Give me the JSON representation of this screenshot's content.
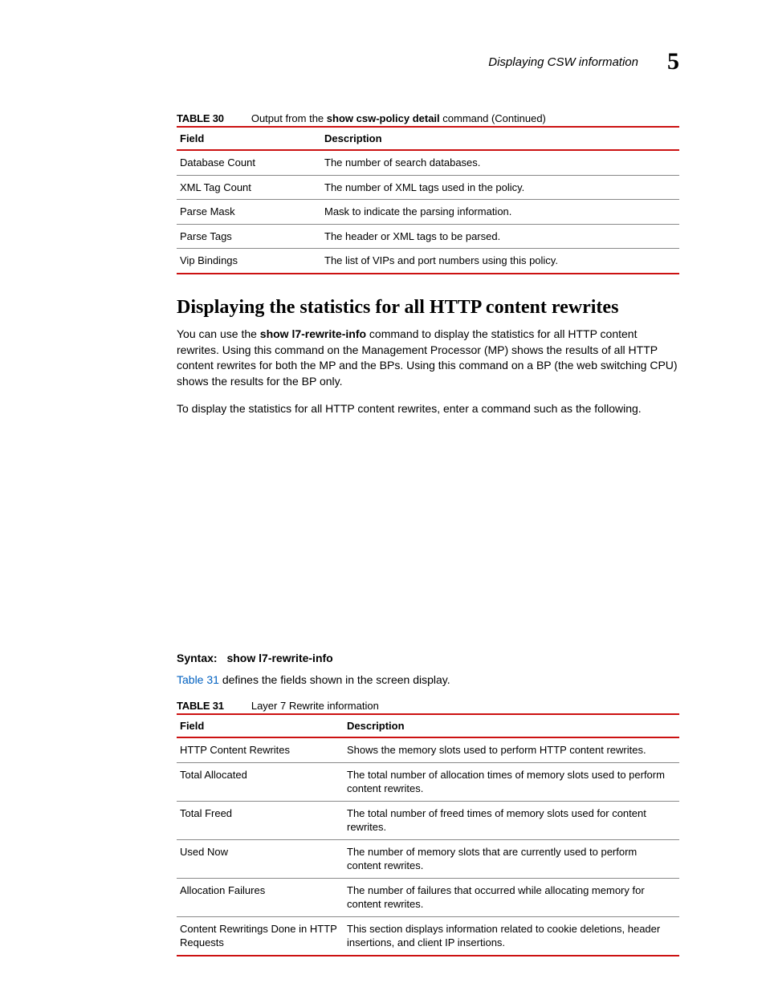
{
  "runhead": {
    "label": "Displaying CSW information",
    "chapter": "5"
  },
  "table30": {
    "caption_num": "TABLE 30",
    "caption_pre": "Output from the ",
    "caption_bold": "show csw-policy detail",
    "caption_post": " command (Continued)",
    "head_field": "Field",
    "head_desc": "Description",
    "rows": [
      {
        "f": "Database Count",
        "d": "The number of search databases."
      },
      {
        "f": "XML Tag Count",
        "d": "The number of XML tags used in the policy."
      },
      {
        "f": "Parse Mask",
        "d": "Mask to indicate the parsing information."
      },
      {
        "f": "Parse Tags",
        "d": "The header or XML tags to be parsed."
      },
      {
        "f": "Vip Bindings",
        "d": "The list of VIPs and port numbers using this policy."
      }
    ]
  },
  "section_heading": "Displaying the statistics for all HTTP content rewrites",
  "para1_pre": "You can use the ",
  "para1_bold": "show l7-rewrite-info",
  "para1_post": " command to display the statistics for all HTTP content rewrites. Using this command on the Management Processor (MP) shows the results of all HTTP content rewrites for both the MP and the BPs. Using this command on a BP (the web switching CPU) shows the results for the BP only.",
  "para2": "To display the statistics for all HTTP content rewrites, enter a command such as the following.",
  "syntax_label": "Syntax:",
  "syntax_cmd": "show l7-rewrite-info",
  "xref_link": "Table 31",
  "xref_rest": " defines the fields shown in the screen display.",
  "table31": {
    "caption_num": "TABLE 31",
    "caption_title": "Layer 7 Rewrite information",
    "head_field": "Field",
    "head_desc": "Description",
    "rows": [
      {
        "f": "HTTP Content Rewrites",
        "d": "Shows the memory slots used to perform HTTP content rewrites."
      },
      {
        "f": "Total Allocated",
        "d": "The total number of allocation times of memory slots used to perform content rewrites."
      },
      {
        "f": "Total Freed",
        "d": "The total number of freed times of memory slots used for content rewrites."
      },
      {
        "f": "Used Now",
        "d": "The number of memory slots that are currently used to perform content rewrites."
      },
      {
        "f": "Allocation Failures",
        "d": "The number of failures that occurred while allocating memory for content rewrites."
      },
      {
        "f": "Content Rewritings Done in HTTP Requests",
        "d": "This section displays information related to cookie deletions, header insertions, and client IP insertions."
      }
    ]
  }
}
